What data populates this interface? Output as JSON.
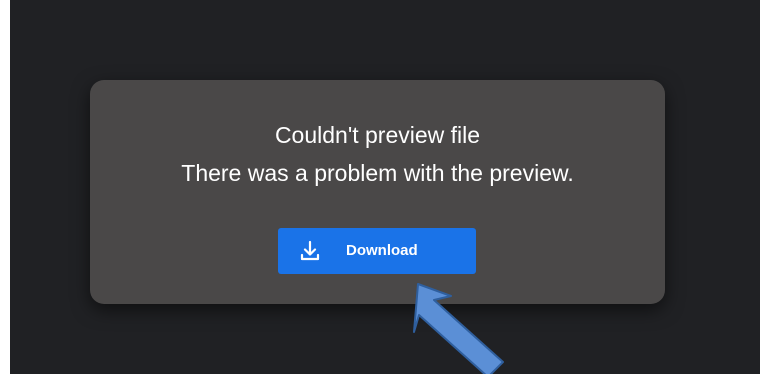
{
  "preview_error": {
    "title": "Couldn't preview file",
    "message": "There was a problem with the preview.",
    "download_button_label": "Download",
    "download_icon": "download-icon"
  },
  "colors": {
    "background": "#202124",
    "dialog": "#4a4848",
    "button": "#1a73e8",
    "annotation_arrow": "#5b8fd6"
  }
}
